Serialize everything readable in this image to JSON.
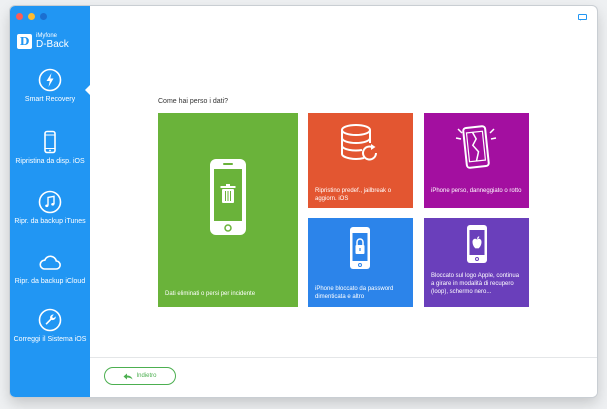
{
  "app": {
    "brand_small": "iMyfone",
    "brand_large": "D-Back",
    "logo_letter": "D"
  },
  "sidebar": {
    "items": [
      {
        "label": "Smart Recovery",
        "icon": "lightning-icon",
        "active": true
      },
      {
        "label": "Ripristina da disp. iOS",
        "icon": "iphone-icon"
      },
      {
        "label": "Ripr. da backup iTunes",
        "icon": "music-note-icon"
      },
      {
        "label": "Ripr. da backup iCloud",
        "icon": "cloud-icon"
      },
      {
        "label": "Correggi il Sistema iOS",
        "icon": "wrench-icon"
      }
    ]
  },
  "main": {
    "question": "Come hai perso i dati?",
    "tiles": [
      {
        "label": "Dati eliminati o persi per incidente",
        "color": "#6ab33a",
        "icon": "phone-trash-icon"
      },
      {
        "label": "Ripristino predef., jailbreak o aggiorn. iOS",
        "color": "#e35631",
        "icon": "database-refresh-icon"
      },
      {
        "label": "iPhone perso, danneggiato o rotto",
        "color": "#a30fa0",
        "icon": "broken-phone-icon"
      },
      {
        "label": "iPhone bloccato da password dimenticata e altro",
        "color": "#2c84ea",
        "icon": "phone-lock-icon"
      },
      {
        "label": "Bloccato sul logo Apple, continua a girare in modalità di recupero (loop), schermo nero...",
        "color": "#6a3fbb",
        "icon": "phone-apple-icon"
      }
    ]
  },
  "footer": {
    "back_label": "Indietro"
  }
}
